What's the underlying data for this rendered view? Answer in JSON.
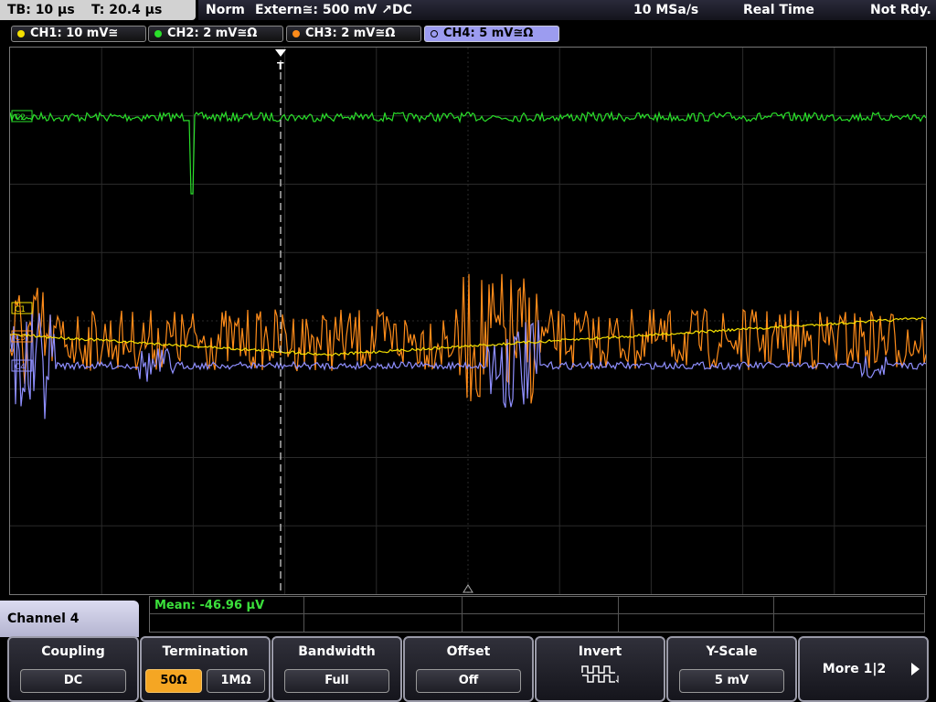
{
  "header": {
    "timebase": "TB: 10 μs",
    "trigger_time": "T: 20.4 μs",
    "mode": "Norm",
    "trigger_source": "Extern≅: 500 mV ↗DC",
    "sample_rate": "10 MSa/s",
    "acq_mode": "Real Time",
    "status": "Not Rdy."
  },
  "channels": [
    {
      "label": "CH1: 10 mV≅",
      "color": "#f5e000"
    },
    {
      "label": "CH2: 2 mV≅Ω",
      "color": "#2adf2a"
    },
    {
      "label": "CH3: 2 mV≅Ω",
      "color": "#ff8c1a"
    },
    {
      "label": "CH4: 5 mV≅Ω",
      "color": "#8f8fff"
    }
  ],
  "markers": {
    "ch1": "C1",
    "ch2": "C2",
    "ch3": "C3",
    "ch4": "C4",
    "trigger": "T"
  },
  "measurement": {
    "mean": "Mean: -46.96 μV"
  },
  "menu": {
    "title": "Channel 4",
    "coupling": {
      "label": "Coupling",
      "value": "DC"
    },
    "termination": {
      "label": "Termination",
      "opt_a": "50Ω",
      "opt_b": "1MΩ"
    },
    "bandwidth": {
      "label": "Bandwidth",
      "value": "Full"
    },
    "offset": {
      "label": "Offset",
      "value": "Off"
    },
    "invert": {
      "label": "Invert"
    },
    "yscale": {
      "label": "Y-Scale",
      "value": "5 mV"
    },
    "more": {
      "label": "More 1|2"
    }
  }
}
